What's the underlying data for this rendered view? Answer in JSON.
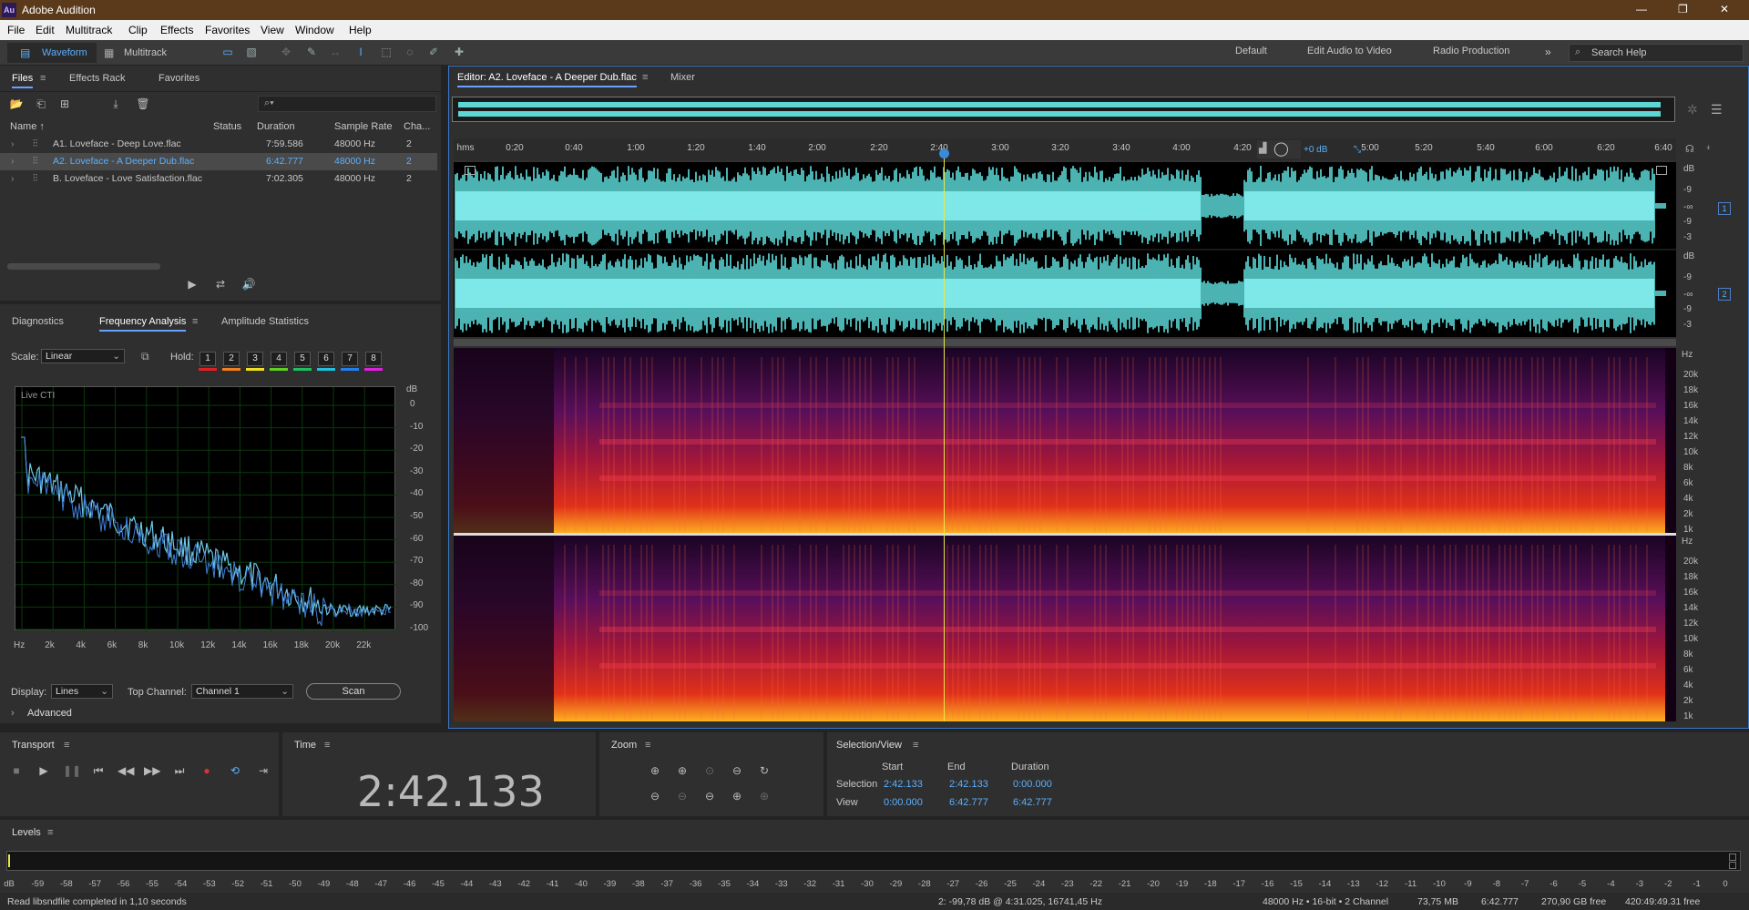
{
  "app": {
    "title": "Adobe Audition",
    "logo": "Au",
    "window_controls": [
      "—",
      "❐",
      "✕"
    ]
  },
  "menu": [
    "File",
    "Edit",
    "Multitrack",
    "Clip",
    "Effects",
    "Favorites",
    "View",
    "Window",
    "Help"
  ],
  "toolbar": {
    "waveform": "Waveform",
    "multitrack": "Multitrack",
    "workspaces": [
      "Default",
      "Edit Audio to Video",
      "Radio Production"
    ],
    "more": "»",
    "search_placeholder": "Search Help"
  },
  "files_panel": {
    "tabs": [
      "Files",
      "Effects Rack",
      "Favorites"
    ],
    "search_icon": "⌕▾",
    "columns": [
      "Name ↑",
      "Status",
      "Duration",
      "Sample Rate",
      "Cha..."
    ],
    "rows": [
      {
        "name": "A1. Loveface - Deep Love.flac",
        "status": "",
        "duration": "7:59.586",
        "rate": "48000 Hz",
        "ch": "2"
      },
      {
        "name": "A2. Loveface - A Deeper Dub.flac",
        "status": "",
        "duration": "6:42.777",
        "rate": "48000 Hz",
        "ch": "2"
      },
      {
        "name": "B. Loveface - Love Satisfaction.flac",
        "status": "",
        "duration": "7:02.305",
        "rate": "48000 Hz",
        "ch": "2"
      }
    ]
  },
  "analysis_panel": {
    "tabs": [
      "Diagnostics",
      "Frequency Analysis",
      "Amplitude Statistics"
    ],
    "scale_label": "Scale:",
    "scale_value": "Linear",
    "hold_label": "Hold:",
    "hold": [
      "1",
      "2",
      "3",
      "4",
      "5",
      "6",
      "7",
      "8"
    ],
    "hold_colors": [
      "#e02020",
      "#f08020",
      "#f0e020",
      "#60d020",
      "#20c060",
      "#20c0e0",
      "#2080f0",
      "#e020e0"
    ],
    "graph_label": "Live CTI",
    "y_unit": "dB",
    "y_ticks": [
      "0",
      "-10",
      "-20",
      "-30",
      "-40",
      "-50",
      "-60",
      "-70",
      "-80",
      "-90",
      "-100"
    ],
    "x_ticks": [
      "Hz",
      "2k",
      "4k",
      "6k",
      "8k",
      "10k",
      "12k",
      "14k",
      "16k",
      "18k",
      "20k",
      "22k"
    ],
    "display_label": "Display:",
    "display_value": "Lines",
    "top_channel_label": "Top Channel:",
    "top_channel_value": "Channel 1",
    "scan": "Scan",
    "advanced": "Advanced"
  },
  "editor": {
    "tab": "Editor: A2. Loveface - A Deeper Dub.flac",
    "mixer": "Mixer",
    "ruler": [
      "hms",
      "0:20",
      "0:40",
      "1:00",
      "1:20",
      "1:40",
      "2:00",
      "2:20",
      "2:40",
      "3:00",
      "3:20",
      "3:40",
      "4:00",
      "4:20",
      "5:00",
      "5:20",
      "5:40",
      "6:00",
      "6:20",
      "6:40"
    ],
    "gain": "+0 dB",
    "db_labels_ch": [
      "dB",
      "-9",
      "-∞",
      "-9",
      "-3"
    ],
    "channels": [
      "1",
      "2"
    ],
    "hz_labels": [
      "Hz",
      "20k",
      "18k",
      "16k",
      "14k",
      "12k",
      "10k",
      "8k",
      "6k",
      "4k",
      "2k",
      "1k"
    ]
  },
  "transport": {
    "title": "Transport",
    "icons": [
      "stop-icon",
      "play-icon",
      "pause-icon",
      "go-to-start-icon",
      "rewind-icon",
      "fast-forward-icon",
      "go-to-end-icon",
      "record-icon",
      "loop-icon",
      "skip-icon"
    ]
  },
  "time": {
    "title": "Time",
    "value": "2:42.133"
  },
  "zoom": {
    "title": "Zoom"
  },
  "selection": {
    "title": "Selection/View",
    "headers": [
      "Start",
      "End",
      "Duration"
    ],
    "selection_label": "Selection",
    "selection_values": [
      "2:42.133",
      "2:42.133",
      "0:00.000"
    ],
    "view_label": "View",
    "view_values": [
      "0:00.000",
      "6:42.777",
      "6:42.777"
    ]
  },
  "levels": {
    "title": "Levels",
    "scale": [
      "dB",
      "-59",
      "-58",
      "-57",
      "-56",
      "-55",
      "-54",
      "-53",
      "-52",
      "-51",
      "-50",
      "-49",
      "-48",
      "-47",
      "-46",
      "-45",
      "-44",
      "-43",
      "-42",
      "-41",
      "-40",
      "-39",
      "-38",
      "-37",
      "-36",
      "-35",
      "-34",
      "-33",
      "-32",
      "-31",
      "-30",
      "-29",
      "-28",
      "-27",
      "-26",
      "-25",
      "-24",
      "-23",
      "-22",
      "-21",
      "-20",
      "-19",
      "-18",
      "-17",
      "-16",
      "-15",
      "-14",
      "-13",
      "-12",
      "-11",
      "-10",
      "-9",
      "-8",
      "-7",
      "-6",
      "-5",
      "-4",
      "-3",
      "-2",
      "-1",
      "0"
    ]
  },
  "statusbar": {
    "left": "Read libsndfile completed in 1,10 seconds",
    "cursor": "2: -99,78 dB @ 4:31.025, 16741,45 Hz",
    "format": "48000 Hz • 16-bit • 2 Channel",
    "size": "73,75 MB",
    "duration": "6:42.777",
    "free": "270,90 GB free",
    "time_free": "420:49:49.31 free"
  }
}
